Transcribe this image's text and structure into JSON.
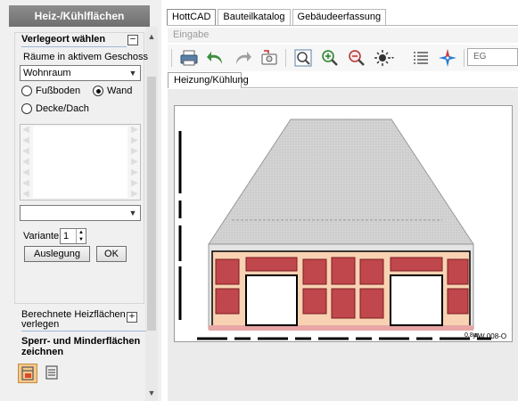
{
  "left_panel": {
    "title": "Heiz-/Kühlflächen",
    "location": {
      "title": "Verlegeort wählen",
      "collapse_symbol": "−",
      "rooms_label": "Räume in aktivem Geschoss",
      "room_select": "Wohnraum",
      "radios": [
        {
          "label": "Fußboden",
          "checked": false
        },
        {
          "label": "Wand",
          "checked": true
        },
        {
          "label": "Decke/Dach",
          "checked": false
        }
      ],
      "variant_label": "Variante",
      "variant_value": "1",
      "design_button": "Auslegung",
      "ok_button": "OK"
    },
    "heat_label": "Berechnete Heizflächen verlegen",
    "expand_symbol": "+",
    "sperr_label": "Sperr- und Minderflächen zeichnen"
  },
  "tabs": [
    "HottCAD",
    "Bauteilkatalog",
    "Gebäudeerfassung"
  ],
  "active_tab": 0,
  "input_bar": "Eingabe",
  "toolbar": {
    "icons": [
      "print-icon",
      "undo-icon",
      "redo-icon",
      "photo-icon",
      "zoom-window-icon",
      "zoom-in-icon",
      "zoom-out-icon",
      "light-icon",
      "list-icon",
      "compass-icon"
    ],
    "level_value": "EG"
  },
  "subtab": "Heizung/Kühlung",
  "drawing": {
    "scale_label": "0,8m",
    "wall_label": "AW 008-O",
    "colors": {
      "roof": "#d4d4d4",
      "wall": "#f8d2b3",
      "panel": "#c0474c",
      "panel_border": "#7a1e22",
      "floor_strip": "#e8a6a6"
    }
  }
}
